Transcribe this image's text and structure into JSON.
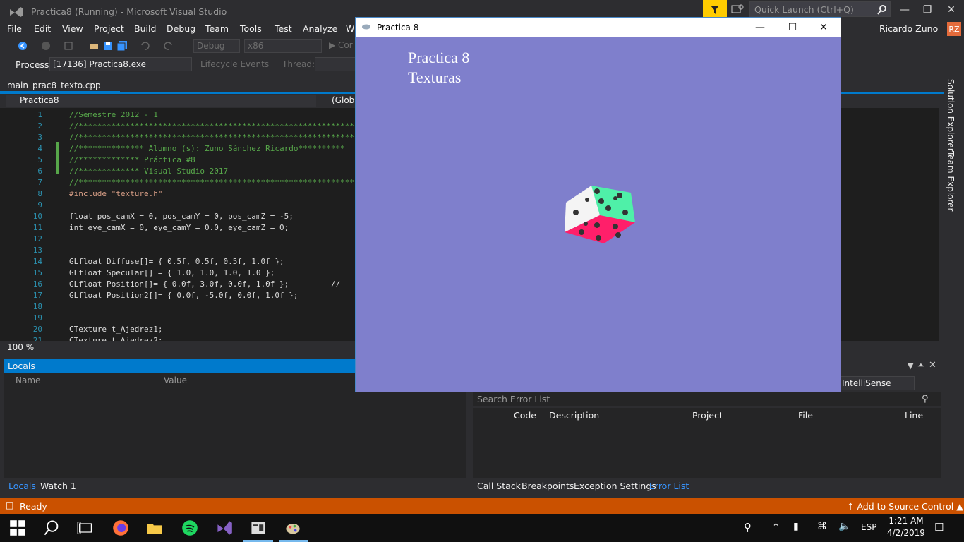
{
  "window": {
    "title": "Practica8 (Running) - Microsoft Visual Studio"
  },
  "quick_launch": {
    "placeholder": "Quick Launch (Ctrl+Q)"
  },
  "menu": [
    "File",
    "Edit",
    "View",
    "Project",
    "Build",
    "Debug",
    "Team",
    "Tools",
    "Test",
    "Analyze",
    "W"
  ],
  "user": {
    "name": "Ricardo Zuno",
    "initials": "RZ"
  },
  "toolbar": {
    "config": "Debug",
    "platform": "x86",
    "continue_label": "Cor",
    "process_label": "Process:",
    "process_value": "[17136] Practica8.exe",
    "lifecycle": "Lifecycle Events",
    "thread_label": "Thread:"
  },
  "editor": {
    "tab_name": "main_prac8_texto.cpp",
    "project": "Practica8",
    "scope": "(Globa",
    "zoom": "100 %",
    "lines": [
      {
        "n": "1",
        "t": "//Semestre 2012 - 1",
        "c": "cm"
      },
      {
        "n": "2",
        "t": "//************************************************************",
        "c": "cm"
      },
      {
        "n": "3",
        "t": "//************************************************************",
        "c": "cm"
      },
      {
        "n": "4",
        "t": "//************** Alumno (s): Zuno Sánchez Ricardo**********",
        "c": "cm"
      },
      {
        "n": "5",
        "t": "//************* Práctica #8",
        "c": "cm"
      },
      {
        "n": "6",
        "t": "//************* Visual Studio 2017",
        "c": "cm"
      },
      {
        "n": "7",
        "t": "//************************************************************",
        "c": "cm"
      },
      {
        "n": "8",
        "t": "#include \"texture.h\"",
        "c": "st"
      },
      {
        "n": "9",
        "t": "",
        "c": ""
      },
      {
        "n": "10",
        "t": "float pos_camX = 0, pos_camY = 0, pos_camZ = -5;",
        "c": ""
      },
      {
        "n": "11",
        "t": "int eye_camX = 0, eye_camY = 0.0, eye_camZ = 0;",
        "c": ""
      },
      {
        "n": "12",
        "t": "",
        "c": ""
      },
      {
        "n": "13",
        "t": "",
        "c": ""
      },
      {
        "n": "14",
        "t": "GLfloat Diffuse[]= { 0.5f, 0.5f, 0.5f, 1.0f };",
        "c": ""
      },
      {
        "n": "15",
        "t": "GLfloat Specular[] = { 1.0, 1.0, 1.0, 1.0 };",
        "c": ""
      },
      {
        "n": "16",
        "t": "GLfloat Position[]= { 0.0f, 3.0f, 0.0f, 1.0f };         //",
        "c": ""
      },
      {
        "n": "17",
        "t": "GLfloat Position2[]= { 0.0f, -5.0f, 0.0f, 1.0f };",
        "c": ""
      },
      {
        "n": "18",
        "t": "",
        "c": ""
      },
      {
        "n": "19",
        "t": "",
        "c": ""
      },
      {
        "n": "20",
        "t": "CTexture t_Ajedrez1;",
        "c": ""
      },
      {
        "n": "21",
        "t": "CTexture t_Ajedrez2;",
        "c": ""
      }
    ]
  },
  "locals": {
    "title": "Locals",
    "col_name": "Name",
    "col_value": "Value"
  },
  "bottom_tabs_left": [
    "Locals",
    "Watch 1"
  ],
  "bottom_tabs_right": [
    "Call Stack",
    "Breakpoints",
    "Exception Settings",
    "Error List"
  ],
  "error_list": {
    "search_placeholder": "Search Error List",
    "filter": "IntelliSense",
    "columns": [
      "Code",
      "Description",
      "Project",
      "File",
      "Line"
    ]
  },
  "side_tabs": [
    "Solution Explorer",
    "Team Explorer"
  ],
  "status": {
    "text": "Ready",
    "source_control": "Add to Source Control"
  },
  "practica": {
    "title": "Practica 8",
    "line1": "Practica 8",
    "line2": "Texturas"
  },
  "taskbar": {
    "time": "1:21 AM",
    "date": "4/2/2019",
    "lang": "ESP"
  },
  "colors": {
    "accent": "#007acc",
    "status_bar": "#ca5100",
    "gl_background": "#7f7fcc"
  }
}
